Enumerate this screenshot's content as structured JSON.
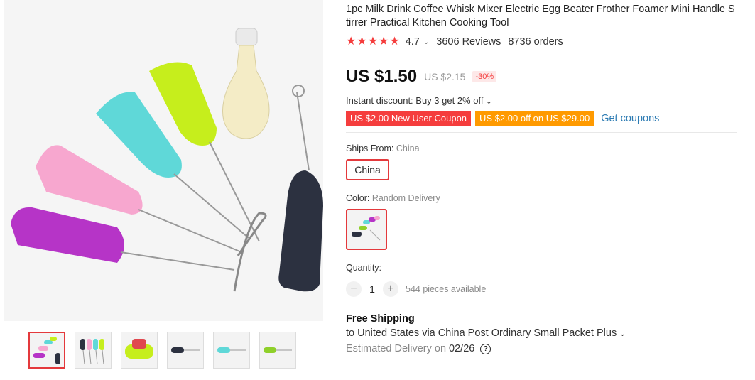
{
  "product": {
    "title": "1pc Milk Drink Coffee Whisk Mixer Electric Egg Beater Frother Foamer Mini Handle Stirrer Practical Kitchen Cooking Tool",
    "rating": "4.7",
    "reviews": "3606 Reviews",
    "orders": "8736 orders",
    "price": "US $1.50",
    "old_price": "US $2.15",
    "discount": "-30%",
    "instant_discount": "Instant discount: Buy 3 get 2% off",
    "coupon_new_user": "US $2.00 New User Coupon",
    "coupon_off": "US $2.00 off on US $29.00",
    "get_coupons": "Get coupons"
  },
  "ships_from": {
    "label": "Ships From:",
    "value": "China",
    "option": "China"
  },
  "color": {
    "label": "Color:",
    "value": "Random Delivery"
  },
  "quantity": {
    "label": "Quantity:",
    "minus": "−",
    "value": "1",
    "plus": "+",
    "available": "544 pieces available"
  },
  "shipping": {
    "title": "Free Shipping",
    "line": "to United States via China Post Ordinary Small Packet Plus",
    "est_label": "Estimated Delivery on",
    "est_date": "02/26",
    "help": "?"
  },
  "colors": {
    "accent": "#f53d3d",
    "coupon_orange": "#ff9a00",
    "link": "#2c7bb3"
  }
}
